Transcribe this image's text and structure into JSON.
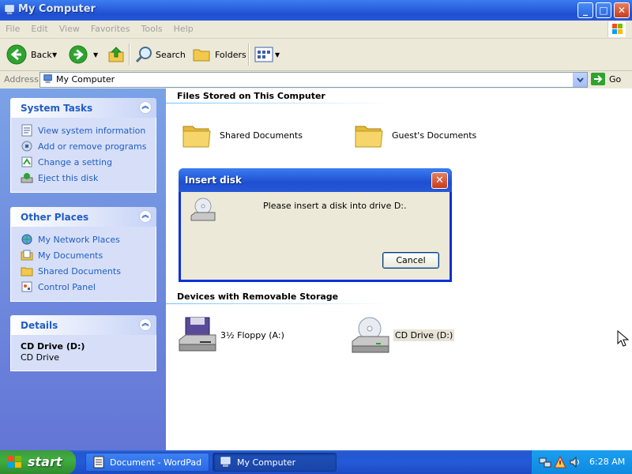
{
  "window": {
    "title": "My Computer"
  },
  "title_buttons": {
    "minimize": "_",
    "maximize": "□",
    "close": "✕"
  },
  "menubar": {
    "items": [
      "File",
      "Edit",
      "View",
      "Favorites",
      "Tools",
      "Help"
    ]
  },
  "toolbar": {
    "back": "Back",
    "search": "Search",
    "folders": "Folders"
  },
  "address": {
    "label": "Address",
    "value": "My Computer",
    "go": "Go"
  },
  "left_pane": {
    "system_tasks": {
      "title": "System Tasks",
      "items": [
        "View system information",
        "Add or remove programs",
        "Change a setting",
        "Eject this disk"
      ]
    },
    "other_places": {
      "title": "Other Places",
      "items": [
        "My Network Places",
        "My Documents",
        "Shared Documents",
        "Control Panel"
      ]
    },
    "details": {
      "title": "Details",
      "name": "CD Drive (D:)",
      "type": "CD Drive"
    }
  },
  "main": {
    "files_section": "Files Stored on This Computer",
    "files": [
      "Shared Documents",
      "Guest's Documents"
    ],
    "removable_section": "Devices with Removable Storage",
    "removable": [
      "3½ Floppy (A:)",
      "CD Drive (D:)"
    ]
  },
  "dialog": {
    "title": "Insert disk",
    "message": "Please insert a disk into drive D:.",
    "cancel": "Cancel"
  },
  "taskbar": {
    "start": "start",
    "buttons": [
      "Document - WordPad",
      "My Computer"
    ],
    "clock": "6:28 AM"
  }
}
